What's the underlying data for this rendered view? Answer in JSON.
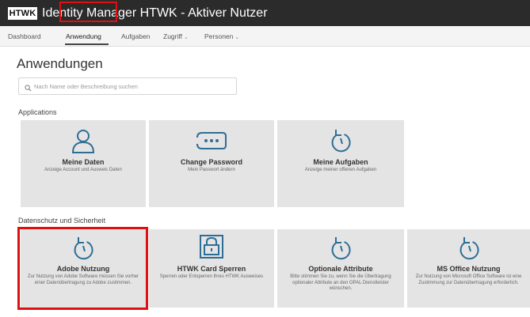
{
  "header": {
    "logo": "HTWK",
    "title": "Identity Manager HTWK - Aktiver Nutzer"
  },
  "nav": {
    "items": [
      {
        "label": "Dashboard"
      },
      {
        "label": "Anwendung"
      },
      {
        "label": "Aufgaben"
      },
      {
        "label": "Zugriff",
        "has_dropdown": true
      },
      {
        "label": "Personen",
        "has_dropdown": true
      }
    ],
    "active": "Anwendung"
  },
  "page": {
    "title": "Anwendungen"
  },
  "search": {
    "placeholder": "Nach Name oder Beschreibung suchen",
    "value": ""
  },
  "sections": [
    {
      "title": "Applications",
      "tiles": [
        {
          "title": "Meine Daten",
          "description": "Anzeige Account und Ausweis Daten",
          "icon": "user-icon"
        },
        {
          "title": "Change Password",
          "description": "Mein Passwort ändern",
          "icon": "password-icon"
        },
        {
          "title": "Meine Aufgaben",
          "description": "Anzeige meiner offenen Aufgaben",
          "icon": "refresh-icon"
        }
      ]
    },
    {
      "title": "Datenschutz und Sicherheit",
      "tiles": [
        {
          "title": "Adobe Nutzung",
          "description": "Zur Nutzung von Adobe Software müssen Sie vorher einer Datenübertragung zu Adobe zustimmen.",
          "icon": "refresh-icon"
        },
        {
          "title": "HTWK Card Sperren",
          "description": "Sperren oder Entsperren Ihres HTWK Ausweises",
          "icon": "lock-card-icon"
        },
        {
          "title": "Optionale Attribute",
          "description": "Bitte stimmen Sie zu, wenn Sie die Übertragung optionaler Attribute an den OPAL Dienstleister wünschen.",
          "icon": "refresh-icon"
        },
        {
          "title": "MS Office Nutzung",
          "description": "Zur Nutzung von Microsoft Office Software ist eine Zustimmung zur Datenübertragung erforderlich.",
          "icon": "refresh-icon"
        }
      ]
    }
  ],
  "colors": {
    "titlebar": "#2b2b2b",
    "nav_bg": "#f4f4f4",
    "tile_bg": "#e4e4e4",
    "icon": "#2d6e96",
    "highlight": "#e01010"
  }
}
